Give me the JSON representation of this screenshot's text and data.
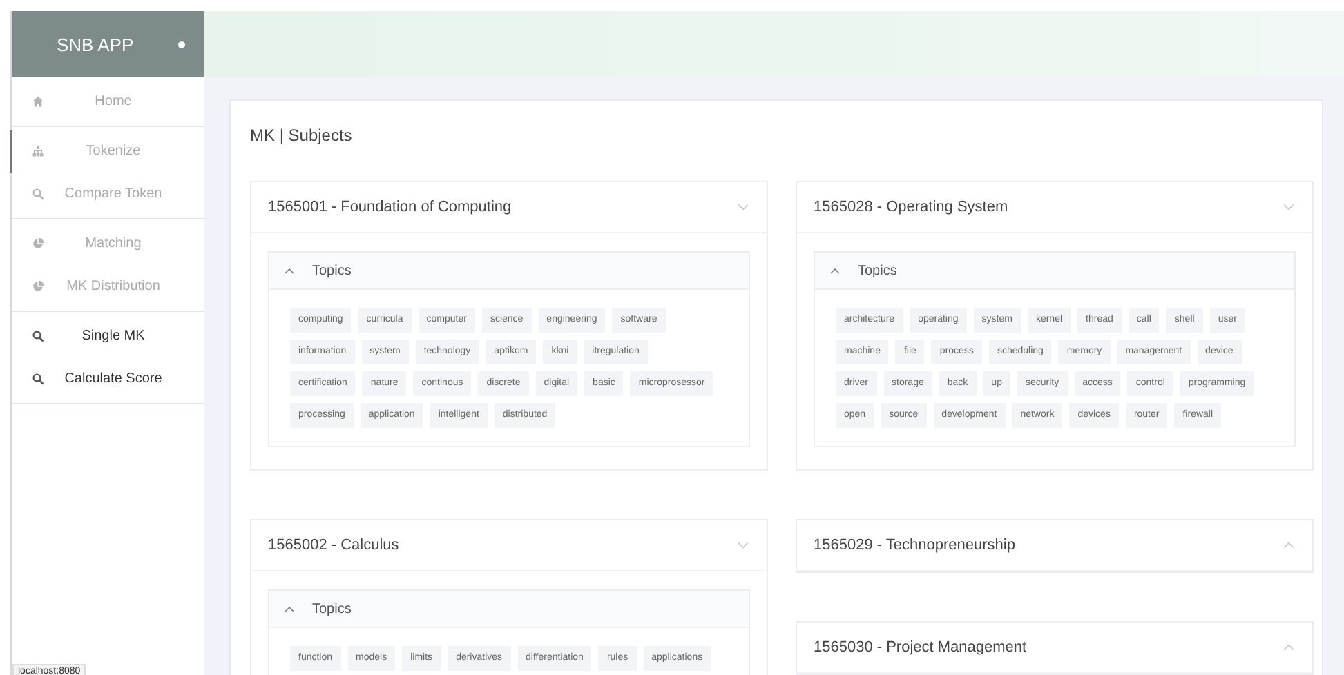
{
  "sidebar": {
    "title": "SNB APP",
    "sections": [
      {
        "items": [
          {
            "label": "Home",
            "kind": "home",
            "selected": false,
            "disabled": true
          }
        ]
      },
      {
        "items": [
          {
            "label": "Tokenize",
            "kind": "hierarchy",
            "selected": true,
            "disabled": true
          },
          {
            "label": "Compare Token",
            "kind": "search",
            "selected": false,
            "disabled": true
          }
        ]
      },
      {
        "items": [
          {
            "label": "Matching",
            "kind": "pie",
            "selected": false,
            "disabled": true
          },
          {
            "label": "MK Distribution",
            "kind": "pie",
            "selected": false,
            "disabled": true
          }
        ]
      },
      {
        "items": [
          {
            "label": "Single MK",
            "kind": "search",
            "selected": false,
            "disabled": false
          },
          {
            "label": "Calculate Score",
            "kind": "search",
            "selected": false,
            "disabled": false
          }
        ]
      }
    ]
  },
  "panel": {
    "title": "MK | Subjects",
    "columns": [
      {
        "subjects": [
          {
            "title": "1565001 - Foundation of Computing",
            "expanded": true,
            "topics": {
              "label": "Topics",
              "expanded": true,
              "tags": [
                "computing",
                "curricula",
                "computer",
                "science",
                "engineering",
                "software",
                "information",
                "system",
                "technology",
                "aptikom",
                "kkni",
                "itregulation",
                "certification",
                "nature",
                "continous",
                "discrete",
                "digital",
                "basic",
                "microprosessor",
                "processing",
                "application",
                "intelligent",
                "distributed"
              ]
            }
          },
          {
            "title": "1565002 - Calculus",
            "expanded": true,
            "topics": {
              "label": "Topics",
              "expanded": true,
              "tags": [
                "function",
                "models",
                "limits",
                "derivatives",
                "differentiation",
                "rules",
                "applications"
              ]
            }
          }
        ]
      },
      {
        "subjects": [
          {
            "title": "1565028 - Operating System",
            "expanded": true,
            "topics": {
              "label": "Topics",
              "expanded": true,
              "tags": [
                "architecture",
                "operating",
                "system",
                "kernel",
                "thread",
                "call",
                "shell",
                "user",
                "machine",
                "file",
                "process",
                "scheduling",
                "memory",
                "management",
                "device",
                "driver",
                "storage",
                "back",
                "up",
                "security",
                "access",
                "control",
                "programming",
                "open",
                "source",
                "development",
                "network",
                "devices",
                "router",
                "firewall"
              ]
            }
          },
          {
            "title": "1565029 - Technopreneurship",
            "expanded": false
          },
          {
            "title": "1565030 - Project Management",
            "expanded": false
          }
        ]
      }
    ]
  },
  "status_bar": {
    "url": "localhost:8080"
  }
}
